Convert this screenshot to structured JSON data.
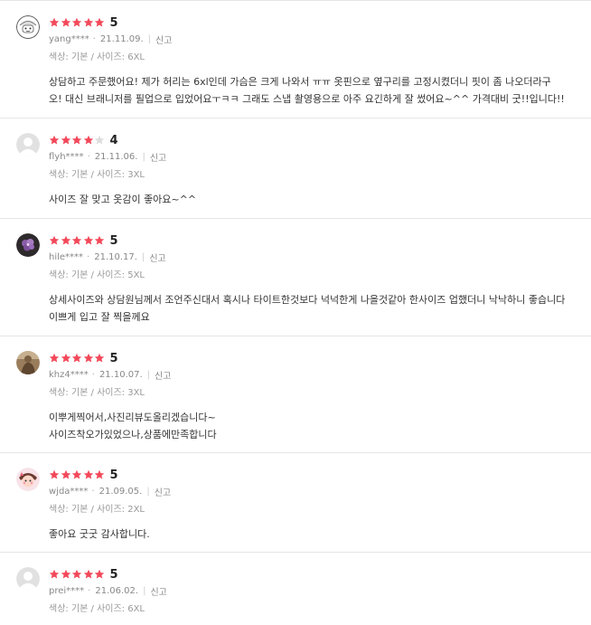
{
  "colors": {
    "star_on": "#f2495a",
    "star_off": "#dddddd",
    "divider": "#e5e5e5"
  },
  "reviews": [
    {
      "avatar": "cartoon-face-avatar",
      "stars": 5,
      "rating": "5",
      "user": "yang****",
      "date": "21.11.09.",
      "report": "신고",
      "option": "색상: 기본 / 사이즈: 6XL",
      "text": "상담하고 주문했어요! 제가 허리는 6xl인데 가슴은 크게 나와서 ㅠㅠ 옷핀으로 옆구리를 고정시켰더니 핏이 좀 나오더라구\n오! 대신 브래니저를 필업으로 입었어요ㅜㅋㅋ 그래도 스냅 촬영용으로 아주 요긴하게 잘 썼어요~^^ 가격대비 굿!!입니다!!"
    },
    {
      "avatar": "default-user-avatar",
      "stars": 4,
      "rating": "4",
      "user": "flyh****",
      "date": "21.11.06.",
      "report": "신고",
      "option": "색상: 기본 / 사이즈: 3XL",
      "text": "사이즈 잘 맞고 옷감이 좋아요~^^"
    },
    {
      "avatar": "purple-flower-avatar",
      "stars": 5,
      "rating": "5",
      "user": "hile****",
      "date": "21.10.17.",
      "report": "신고",
      "option": "색상: 기본 / 사이즈: 5XL",
      "text": "상세사이즈와 상담원님께서 조언주신대서 혹시나 타이트한것보다 넉넉한게 나을것같아 한사이즈 업했더니 낙낙하니 좋습니다\n이쁘게 입고 잘 찍을께요"
    },
    {
      "avatar": "brown-photo-avatar",
      "stars": 5,
      "rating": "5",
      "user": "khz4****",
      "date": "21.10.07.",
      "report": "신고",
      "option": "색상: 기본 / 사이즈: 3XL",
      "text": "이뿌게찍어서,사진리뷰도올리겠습니다~\n사이즈착오가있었으나,상품에만족합니다"
    },
    {
      "avatar": "pink-character-avatar",
      "stars": 5,
      "rating": "5",
      "user": "wjda****",
      "date": "21.09.05.",
      "report": "신고",
      "option": "색상: 기본 / 사이즈: 2XL",
      "text": "좋아요 굿굿 감사합니다."
    },
    {
      "avatar": "default-user-avatar",
      "stars": 5,
      "rating": "5",
      "user": "prei****",
      "date": "21.06.02.",
      "report": "신고",
      "option": "색상: 기본 / 사이즈: 6XL",
      "text": ""
    }
  ]
}
